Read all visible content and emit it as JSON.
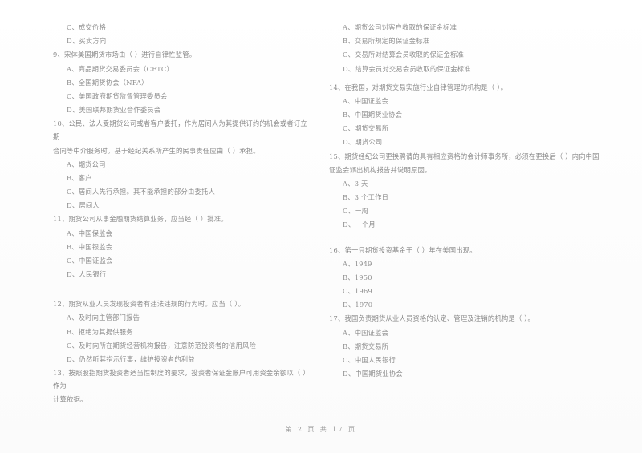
{
  "document": {
    "type": "scanned-exam-paper",
    "language": "zh-CN",
    "background_color": "#ffffff",
    "text_color": "#8b8b8b"
  },
  "footer": {
    "prefix": "第",
    "page_number": "2",
    "middle": "页  共",
    "total_pages": "17",
    "suffix": "页",
    "full_text": "第 2 页  共 17 页"
  },
  "left_column": {
    "carryover_options": [
      {
        "label": "C、成交价格"
      },
      {
        "label": "D、买卖方向"
      }
    ],
    "questions": [
      {
        "number": "9",
        "stem": "9、宋体美国期货市场由（      ）进行自律性监管。",
        "options": [
          {
            "label": "A、商品期货交易委员会（CFTC）"
          },
          {
            "label": "B、全国期货协会（NFA）"
          },
          {
            "label": "C、美国政府期货监督管理委员会"
          },
          {
            "label": "D、美国联邦期货业合作委员会"
          }
        ]
      },
      {
        "number": "10",
        "stem": "10、公民、法人受期货公司或者客户委托，作为居间人为其提供订约的机会或者订立期",
        "stem_line2": "合同等中介服务时。基于经纪关系所产生的民事责任应由（      ）承担。",
        "options": [
          {
            "label": "A、期货公司"
          },
          {
            "label": "B、客户"
          },
          {
            "label": "C、居间人先行承担。其不能承担的部分由委托人"
          },
          {
            "label": "D、居间人"
          }
        ]
      },
      {
        "number": "11",
        "stem": "11、期货公司从事金融期货结算业务，应当经（      ）批准。",
        "options": [
          {
            "label": "A、中国保监会"
          },
          {
            "label": "B、中国银监会"
          },
          {
            "label": "C、中国证监会"
          },
          {
            "label": "D、人民银行"
          }
        ]
      },
      {
        "number": "12",
        "stem": "12、期货从业人员发现投资者有违法违规的行为时。应当（      ）。",
        "options": [
          {
            "label": "A、及时向主管部门报告"
          },
          {
            "label": "B、拒绝为其提供服务"
          },
          {
            "label": "C、及时向所在期货经营机构报告，注意防范投资者的信用风险"
          },
          {
            "label": "D、仍然听其指示行事，维护投资者的利益"
          }
        ]
      },
      {
        "number": "13",
        "stem": "13、按照股指期货投资者适当性制度的要求，投资者保证金账户可用资金余额以（      ）作为",
        "stem_line2": "计算依据。",
        "options": []
      }
    ]
  },
  "right_column": {
    "carryover_options": [
      {
        "label": "A、期货公司对客户收取的保证金标准"
      },
      {
        "label": "B、交易所规定的保证金标准"
      },
      {
        "label": "C、交易所对结算会员收取的保证金标准"
      },
      {
        "label": "D、结算会员对交易会员收取的保证金标准"
      }
    ],
    "questions": [
      {
        "number": "14",
        "stem": "14、在我国，对期货交易实施行业自律管理的机构是（      ）。",
        "options": [
          {
            "label": "A、中国证监会"
          },
          {
            "label": "B、中国期货业协会"
          },
          {
            "label": "C、期货交易所"
          },
          {
            "label": "D、期货公司"
          }
        ]
      },
      {
        "number": "15",
        "stem": "15、期货经纪公司更换聘请的具有相应资格的会计师事务所，必须在更换后（      ）内向中国",
        "stem_line2": "证监会派出机构报告并说明原因。",
        "options": [
          {
            "label": "A、3 天"
          },
          {
            "label": "B、3 个工作日"
          },
          {
            "label": "C、一周"
          },
          {
            "label": "D、一个月"
          }
        ]
      },
      {
        "number": "16",
        "stem": "16、第一只期货投资基金于（      ）年在美国出现。",
        "options": [
          {
            "label": "A、1949"
          },
          {
            "label": "B、1950"
          },
          {
            "label": "C、1969"
          },
          {
            "label": "D、1970"
          }
        ]
      },
      {
        "number": "17",
        "stem": "17、我国负责期货从业人员资格的认定、管理及注销的机构是（      ）。",
        "options": [
          {
            "label": "A、中国证监会"
          },
          {
            "label": "B、期货交易所"
          },
          {
            "label": "C、中国人民银行"
          },
          {
            "label": "D、中国期货业协会"
          }
        ]
      }
    ]
  }
}
